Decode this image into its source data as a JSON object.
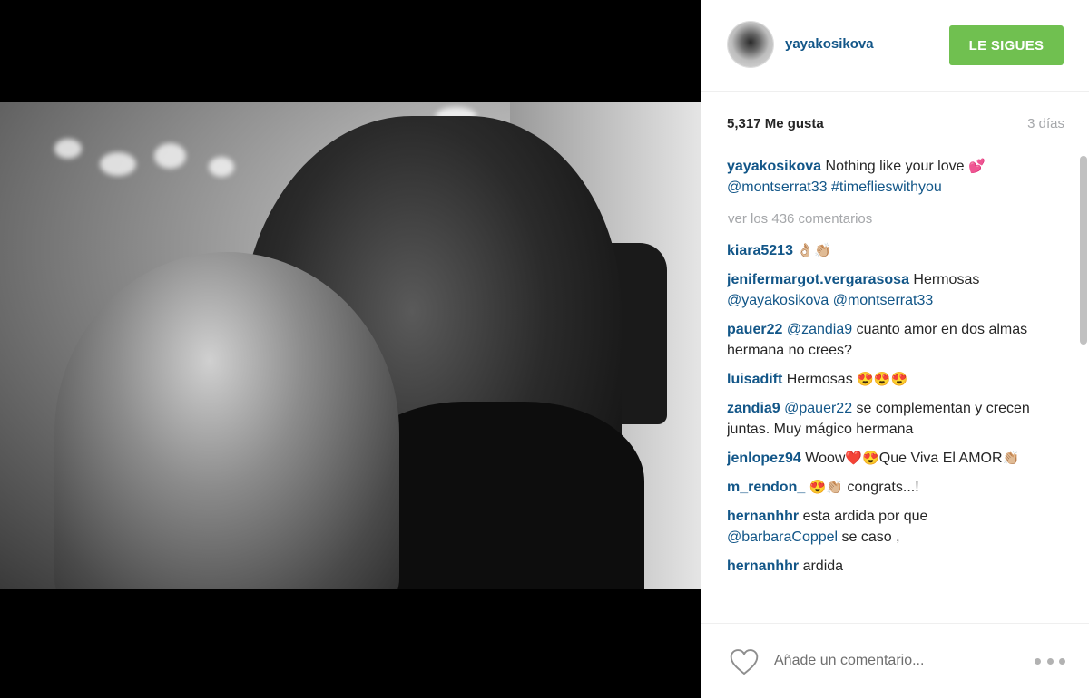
{
  "post": {
    "username": "yayakosikova",
    "follow_label": "LE SIGUES",
    "likes": "5,317 Me gusta",
    "time": "3 días"
  },
  "caption": {
    "user": "yayakosikova",
    "text": " Nothing like your love ",
    "emoji": "💕",
    "mention": "@montserrat33",
    "hashtag": "#timeflieswithyou"
  },
  "view_all": "ver los 436 comentarios",
  "comments": [
    {
      "user": "kiara5213",
      "text": " ",
      "emoji": "👌🏼👏🏼"
    },
    {
      "user": "jenifermargot.vergarasosa",
      "text": " Hermosas ",
      "mentions": "@yayakosikova @montserrat33"
    },
    {
      "user": "pauer22",
      "mention": "@zandia9",
      "text": " cuanto amor en dos almas hermana no crees?"
    },
    {
      "user": "luisadift",
      "text": " Hermosas ",
      "emoji": "😍😍😍"
    },
    {
      "user": "zandia9",
      "mention": "@pauer22",
      "text": " se complementan y crecen juntas. Muy mágico hermana"
    },
    {
      "user": "jenlopez94",
      "text": " Woow",
      "emoji1": "❤️😍",
      "text2": "Que Viva El AMOR",
      "emoji2": "👏🏼"
    },
    {
      "user": "m_rendon_",
      "emoji": "😍👏🏼",
      "text": " congrats...!"
    },
    {
      "user": "hernanhhr",
      "text": " esta ardida por que ",
      "mention": "@barbaraCoppel",
      "text2": " se caso ,"
    },
    {
      "user": "hernanhhr",
      "text": " ardida"
    }
  ],
  "footer": {
    "placeholder": "Añade un comentario...",
    "heart_icon": "heart-outline-icon",
    "more_icon": "more-dots-icon"
  },
  "colors": {
    "link": "#125688",
    "follow_bg": "#70c050",
    "muted": "#a5a7aa"
  }
}
